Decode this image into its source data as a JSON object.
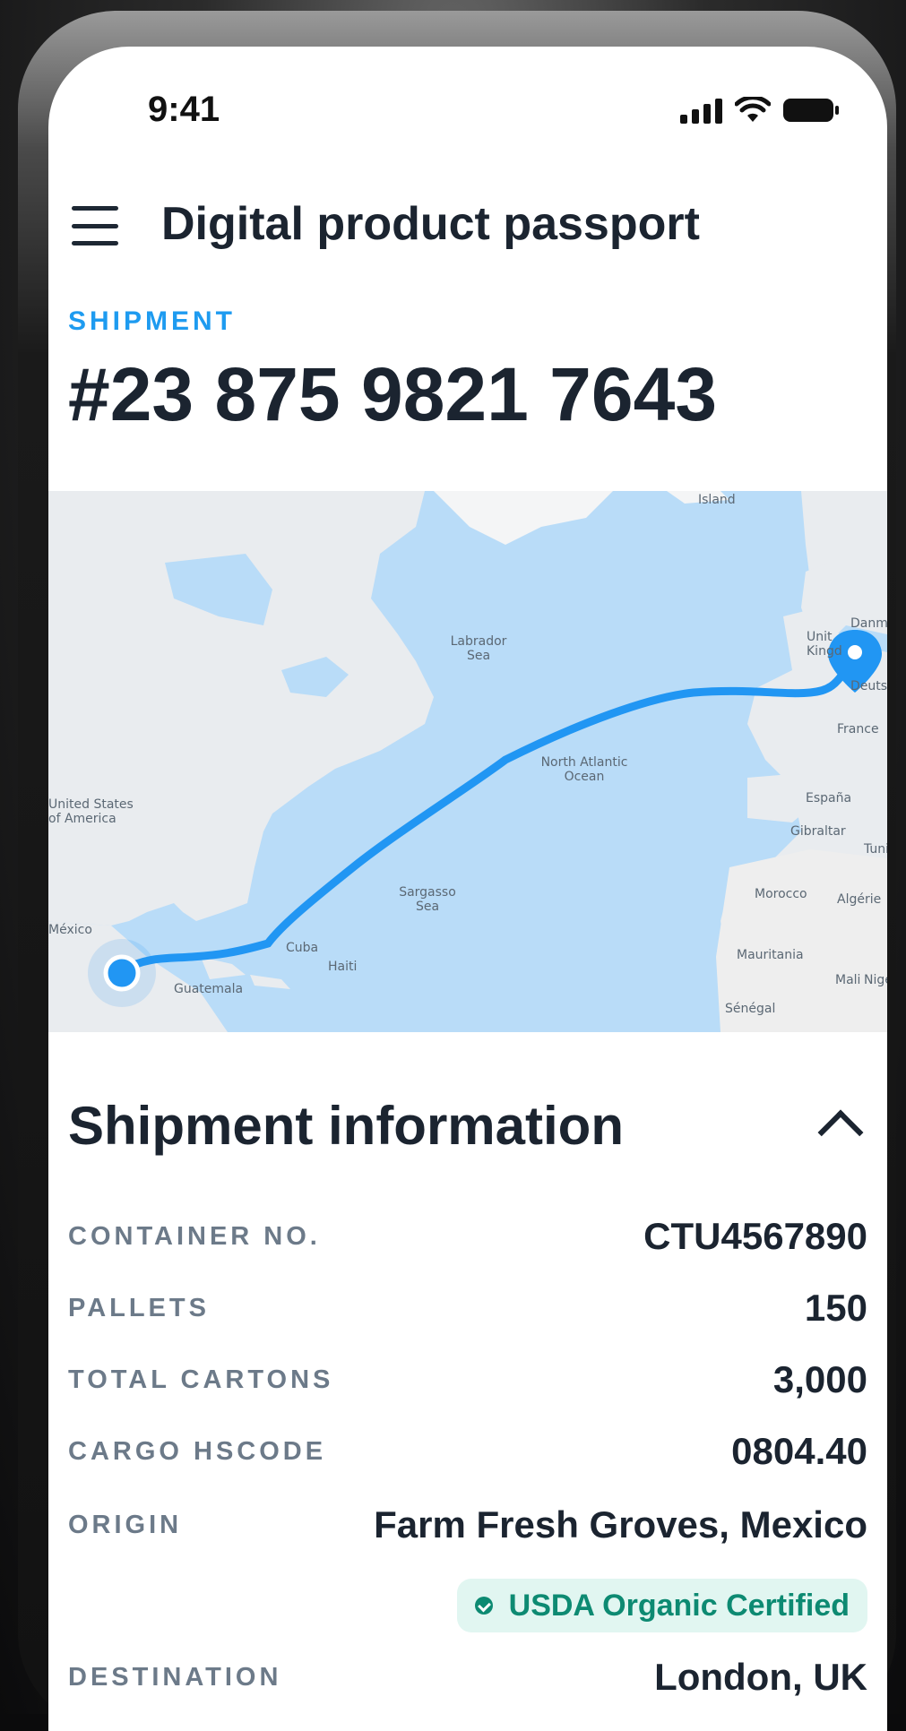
{
  "status_bar": {
    "time": "9:41"
  },
  "app_bar": {
    "title": "Digital product passport"
  },
  "shipment": {
    "label": "SHIPMENT",
    "number": "#23 875 9821 7643"
  },
  "map": {
    "labels": {
      "island": "Island",
      "labrador": "Labrador Sea",
      "united_kingdom": "Unit Kingd",
      "denmark": "Danm",
      "deutschland": "Deutsch",
      "france": "France",
      "north_atlantic": "North Atlantic Ocean",
      "usa": "United States of America",
      "espana": "España",
      "gibraltar": "Gibraltar",
      "tunisia": "Tunisi",
      "sargasso": "Sargasso Sea",
      "morocco": "Morocco",
      "algerie": "Algérie",
      "mexico": "México",
      "cuba": "Cuba",
      "haiti": "Haiti",
      "mauritania": "Mauritania",
      "mali": "Mali",
      "niger": "Nige",
      "guatemala": "Guatemala",
      "senegal": "Sénégal"
    },
    "route_color": "#2196f3"
  },
  "info": {
    "title": "Shipment information",
    "rows": [
      {
        "key": "CONTAINER NO.",
        "value": "CTU4567890"
      },
      {
        "key": "PALLETS",
        "value": "150"
      },
      {
        "key": "TOTAL CARTONS",
        "value": "3,000"
      },
      {
        "key": "CARGO HSCODE",
        "value": "0804.40"
      },
      {
        "key": "ORIGIN",
        "value": "Farm Fresh Groves, Mexico"
      },
      {
        "key": "DESTINATION",
        "value": "London, UK"
      }
    ],
    "badge": "USDA Organic Certified"
  }
}
